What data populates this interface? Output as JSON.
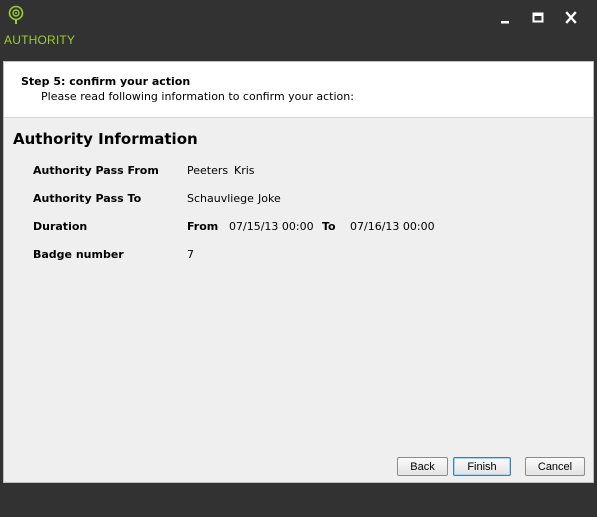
{
  "window": {
    "title": "AUTHORITY",
    "accent_color": "#9ccc2e",
    "controls": [
      "minimize-icon",
      "maximize-icon",
      "close-icon"
    ]
  },
  "step": {
    "title": "Step 5: confirm your action",
    "description": "Please read following information to confirm your action:"
  },
  "section": {
    "title": "Authority Information"
  },
  "info": {
    "pass_from_label": "Authority Pass From",
    "pass_from_last": "Peeters",
    "pass_from_first": "Kris",
    "pass_to_label": "Authority Pass To",
    "pass_to_last": "Schauvliege",
    "pass_to_first": "Joke",
    "duration_label": "Duration",
    "from_label": "From",
    "from_value": "07/15/13 00:00",
    "to_label": "To",
    "to_value": "07/16/13 00:00",
    "badge_label": "Badge number",
    "badge_value": "7"
  },
  "buttons": {
    "back": "Back",
    "finish": "Finish",
    "cancel": "Cancel"
  }
}
